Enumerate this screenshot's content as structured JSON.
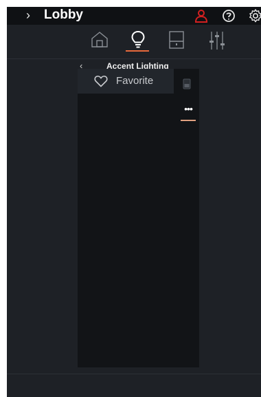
{
  "header": {
    "expand_glyph": "›",
    "title": "Lobby",
    "icons": [
      "user-icon",
      "help-icon",
      "gear-icon"
    ],
    "user_icon_color": "#d42020"
  },
  "tabs": [
    {
      "name": "home",
      "icon": "home-icon",
      "active": false
    },
    {
      "name": "lighting",
      "icon": "lightbulb-icon",
      "active": true
    },
    {
      "name": "shades",
      "icon": "shade-icon",
      "active": false
    },
    {
      "name": "settings",
      "icon": "sliders-icon",
      "active": false
    }
  ],
  "accent_color": "#e86a3c",
  "breadcrumb": {
    "back_glyph": "‹",
    "title": "Accent Lighting"
  },
  "panel": {
    "favorite_label": "Favorite",
    "more_glyph": "•••"
  }
}
